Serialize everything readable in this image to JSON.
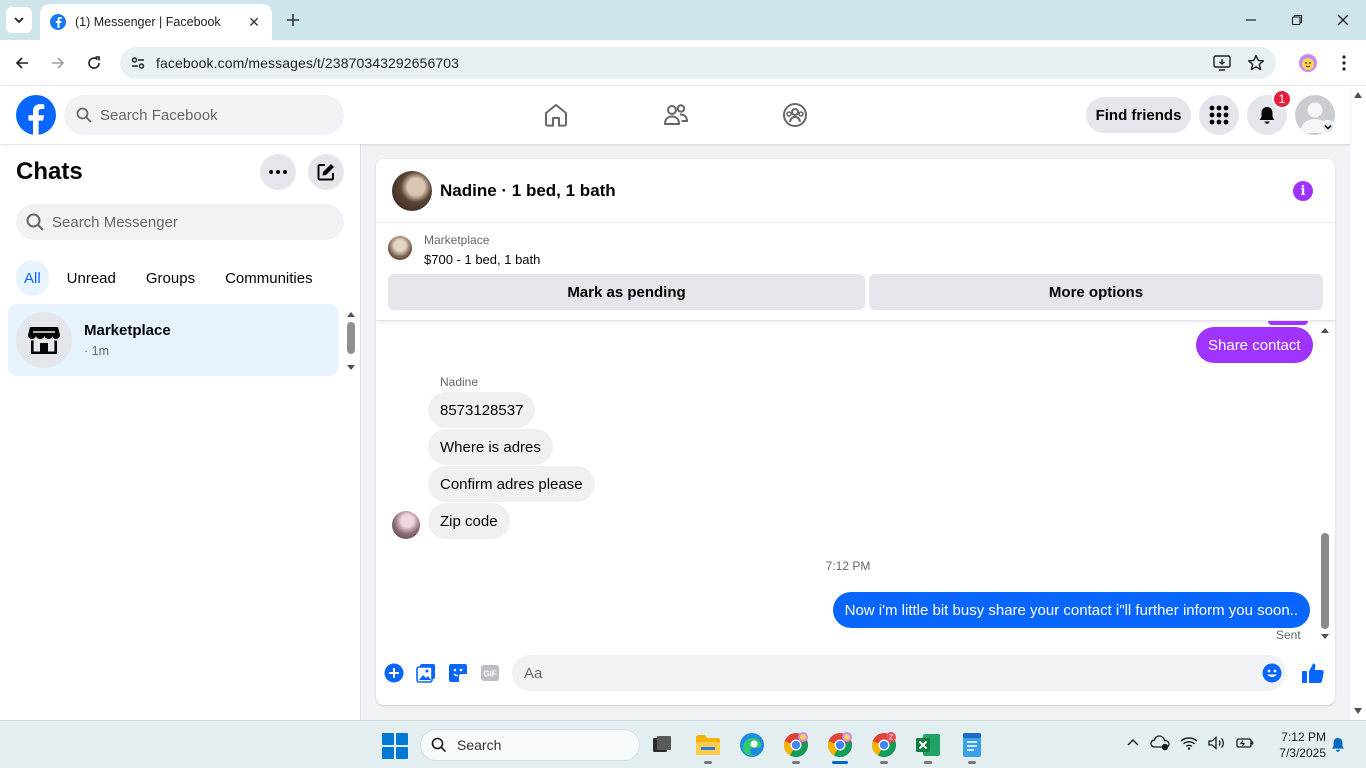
{
  "browser": {
    "tab_title": "(1) Messenger | Facebook",
    "url": "facebook.com/messages/t/23870343292656703"
  },
  "header": {
    "search_placeholder": "Search Facebook",
    "find_friends_label": "Find friends",
    "notification_count": "1"
  },
  "sidebar": {
    "title": "Chats",
    "search_placeholder": "Search Messenger",
    "filters": [
      "All",
      "Unread",
      "Groups",
      "Communities"
    ],
    "active_filter": "All",
    "chats": [
      {
        "name": "Marketplace",
        "meta": "· 1m"
      }
    ]
  },
  "conversation": {
    "title": "Nadine · 1 bed, 1 bath",
    "listing": {
      "source": "Marketplace",
      "title": "$700 - 1 bed, 1 bath",
      "mark_pending_label": "Mark as pending",
      "more_options_label": "More options"
    },
    "share_contact_label": "Share contact",
    "sender_name": "Nadine",
    "incoming_messages": [
      "8573128537",
      "Where is adres",
      "Confirm adres please",
      "Zip code"
    ],
    "timestamp": "7:12 PM",
    "outgoing_message": "Now i'm little bit busy share your contact i\"ll further inform you soon..",
    "status": "Sent",
    "composer_placeholder": "Aa"
  },
  "taskbar": {
    "search_label": "Search",
    "time": "7:12 PM",
    "date": "7/3/2025",
    "chrome_badge": "Z"
  },
  "colors": {
    "facebook_blue": "#0866ff",
    "messenger_purple": "#a033ff",
    "badge_red": "#e41e3f"
  }
}
